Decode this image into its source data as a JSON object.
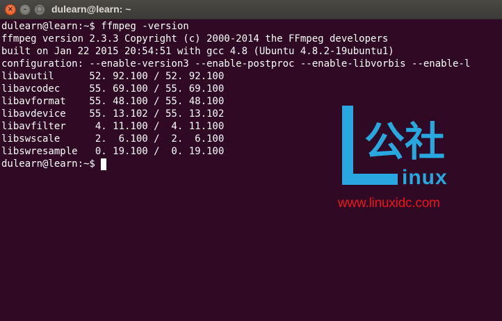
{
  "window": {
    "title": "dulearn@learn: ~"
  },
  "terminal": {
    "lines": [
      "dulearn@learn:~$ ffmpeg -version",
      "ffmpeg version 2.3.3 Copyright (c) 2000-2014 the FFmpeg developers",
      "built on Jan 22 2015 20:54:51 with gcc 4.8 (Ubuntu 4.8.2-19ubuntu1)",
      "configuration: --enable-version3 --enable-postproc --enable-libvorbis --enable-l",
      "libavutil      52. 92.100 / 52. 92.100",
      "libavcodec     55. 69.100 / 55. 69.100",
      "libavformat    55. 48.100 / 55. 48.100",
      "libavdevice    55. 13.102 / 55. 13.102",
      "libavfilter     4. 11.100 /  4. 11.100",
      "libswscale      2.  6.100 /  2.  6.100",
      "libswresample   0. 19.100 /  0. 19.100"
    ],
    "prompt": "dulearn@learn:~$ "
  },
  "watermark": {
    "chars": "公社",
    "brand": "inux",
    "url": "www.linuxidc.com",
    "color_blue": "#29a8e0",
    "color_red": "#e8171e"
  }
}
